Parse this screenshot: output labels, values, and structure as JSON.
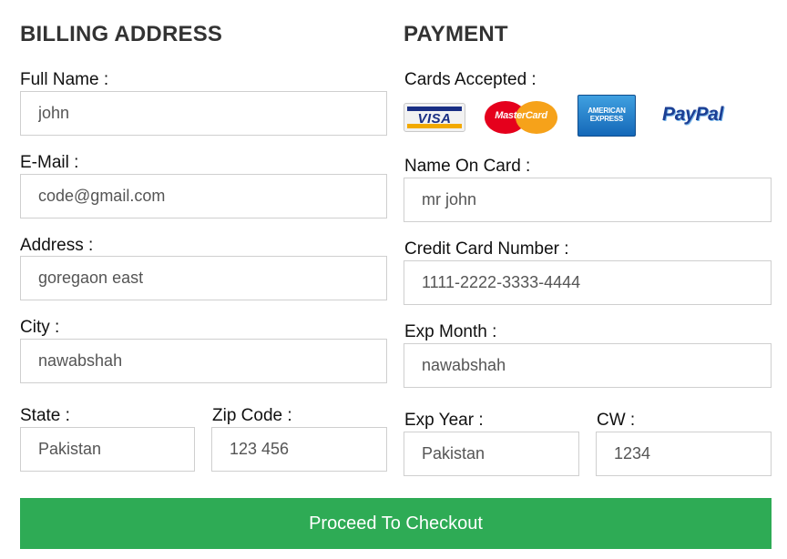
{
  "billing": {
    "title": "BILLING ADDRESS",
    "full_name": {
      "label": "Full Name :",
      "value": "john"
    },
    "email": {
      "label": "E-Mail :",
      "value": "code@gmail.com"
    },
    "address": {
      "label": "Address :",
      "value": "goregaon east"
    },
    "city": {
      "label": "City :",
      "value": "nawabshah"
    },
    "state": {
      "label": "State :",
      "value": "Pakistan"
    },
    "zip": {
      "label": "Zip Code :",
      "value": "123 456"
    }
  },
  "payment": {
    "title": "PAYMENT",
    "cards_label": "Cards Accepted :",
    "cards": [
      {
        "icon": "visa-logo-icon",
        "text": "VISA"
      },
      {
        "icon": "mastercard-logo-icon",
        "text": "MasterCard"
      },
      {
        "icon": "american-express-logo-icon",
        "text": "AMERICAN EXPRESS"
      },
      {
        "icon": "paypal-logo-icon",
        "text": "PayPal"
      }
    ],
    "name_on_card": {
      "label": "Name On Card :",
      "value": "mr john"
    },
    "card_number": {
      "label": "Credit Card Number :",
      "value": "1111-2222-3333-4444"
    },
    "exp_month": {
      "label": "Exp Month :",
      "value": "nawabshah"
    },
    "exp_year": {
      "label": "Exp Year :",
      "value": "Pakistan"
    },
    "cvv": {
      "label": "CW :",
      "value": "1234"
    }
  },
  "checkout_button": "Proceed To Checkout",
  "colors": {
    "button_bg": "#2eab55",
    "button_text": "#ffffff",
    "input_border": "#cfcfcf",
    "title_text": "#333333"
  }
}
